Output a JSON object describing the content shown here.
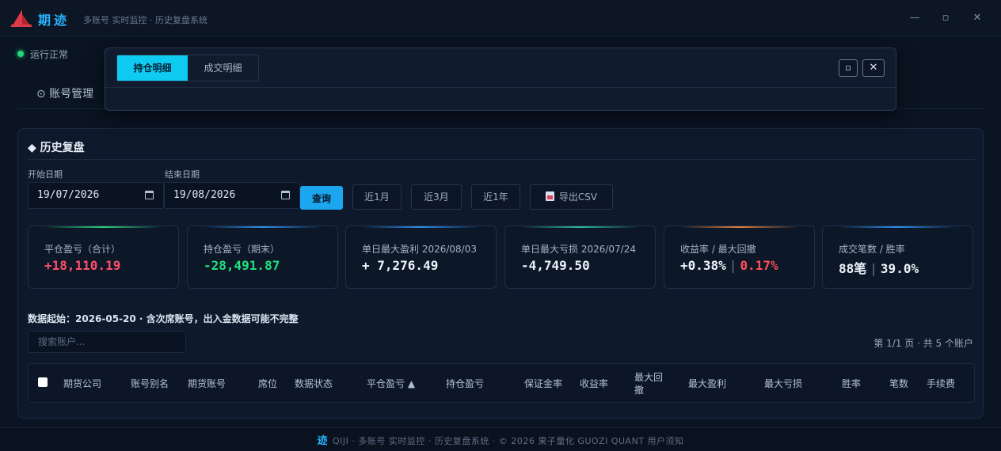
{
  "app": {
    "name": "期迹",
    "subtitle": "多账号 实时监控 · 历史复盘系统",
    "window_min": "—",
    "window_max": "▫",
    "window_close": "✕"
  },
  "status": {
    "text": "运行正常"
  },
  "nav": {
    "account_mgmt": "⊙ 账号管理"
  },
  "modal": {
    "tabs": [
      {
        "label": "持仓明细",
        "active": true
      },
      {
        "label": "成交明细",
        "active": false
      }
    ],
    "maximize_label": "▫",
    "close_label": "✕"
  },
  "panel": {
    "title": "◆ 历史复盘",
    "start_label": "开始日期",
    "end_label": "结束日期",
    "start_date": "19/07/2026",
    "end_date": "19/08/2026",
    "query_btn": "查询",
    "range_btns": [
      "近1月",
      "近3月",
      "近1年"
    ],
    "export_btn": "导出CSV"
  },
  "stats": [
    {
      "label": "平仓盈亏（合计）",
      "value": "+18,110.19",
      "color": "#ff4f6a",
      "glow": "#2bd47a"
    },
    {
      "label": "持仓盈亏（期末）",
      "value": "-28,491.87",
      "color": "#22e07e",
      "glow": "#2d8ff0"
    },
    {
      "label": "单日最大盈利 2026/08/03",
      "value": "+ 7,276.49",
      "color": "#eef3f9",
      "glow": "#2d8ff0"
    },
    {
      "label": "单日最大亏损 2026/07/24",
      "value": "-4,749.50",
      "color": "#eef3f9",
      "glow": "#2dbf9a"
    },
    {
      "label": "收益率 / 最大回撤",
      "value_a": "+0.38%",
      "value_b": "0.17%",
      "color_a": "#eef3f9",
      "color_b": "#ff4f5a",
      "glow": "#e0803a"
    },
    {
      "label": "成交笔数 / 胜率",
      "value_a": "88笔",
      "value_b": "39.0%",
      "color_a": "#eef3f9",
      "color_b": "#eef3f9",
      "glow": "#2d8ff0"
    }
  ],
  "stat_separator": "|",
  "note": "数据起始：2026-05-20 · 含次席账号，出入金数据可能不完整",
  "search": {
    "placeholder": "搜索账户..."
  },
  "pager": "第 1/1 页 · 共 5 个账户",
  "table": {
    "columns": [
      "期货公司",
      "账号别名",
      "期货账号",
      "席位",
      "数据状态",
      "平仓盈亏 ▲",
      "持仓盈亏",
      "保证金率",
      "收益率",
      "最大回撤",
      "最大盈利",
      "最大亏损",
      "胜率",
      "笔数",
      "手续费"
    ]
  },
  "footer": {
    "brand": "迹",
    "text": "QIJI · 多账号 实时监控 · 历史复盘系统 · © 2026 果子量化 GUOZI QUANT   用户须知"
  }
}
